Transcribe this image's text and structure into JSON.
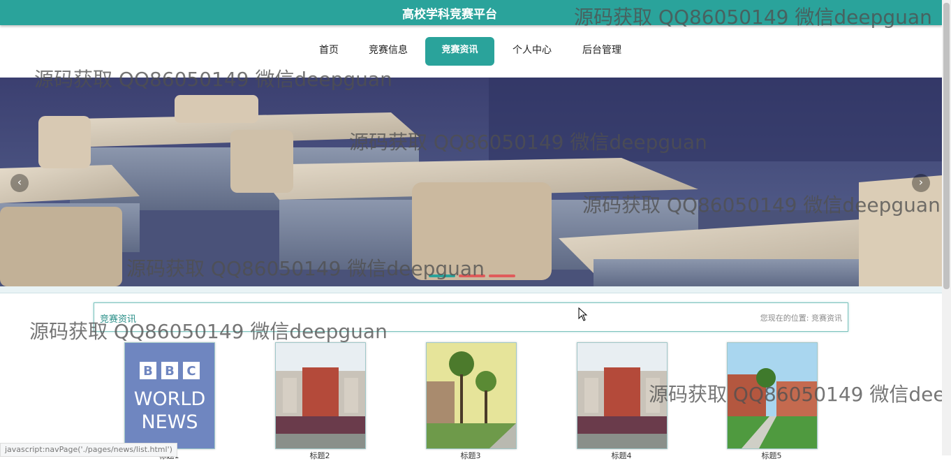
{
  "header": {
    "title": "高校学科竞赛平台"
  },
  "nav": {
    "items": [
      {
        "label": "首页"
      },
      {
        "label": "竞赛信息"
      },
      {
        "label": "竞赛资讯"
      },
      {
        "label": "个人中心"
      },
      {
        "label": "后台管理"
      }
    ],
    "active_index": 2
  },
  "carousel": {
    "prev_icon": "chevron-left-icon",
    "next_icon": "chevron-right-icon",
    "active_dot": 0
  },
  "section": {
    "title": "竞赛资讯",
    "location_prefix": "您现在的位置:",
    "location_current": "竞赛资讯"
  },
  "news_cards": [
    {
      "label": "标题1"
    },
    {
      "label": "标题2"
    },
    {
      "label": "标题3"
    },
    {
      "label": "标题4"
    },
    {
      "label": "标题5"
    }
  ],
  "thumb1": {
    "line1": "BBC",
    "line2": "WORLD",
    "line3": "NEWS"
  },
  "watermark": {
    "text": "源码获取 QQ86050149 微信deepguan"
  },
  "status_bar": {
    "text": "javascript:navPage('./pages/news/list.html')"
  },
  "colors": {
    "primary": "#2aa39b",
    "accent_red": "#e05b5b"
  }
}
